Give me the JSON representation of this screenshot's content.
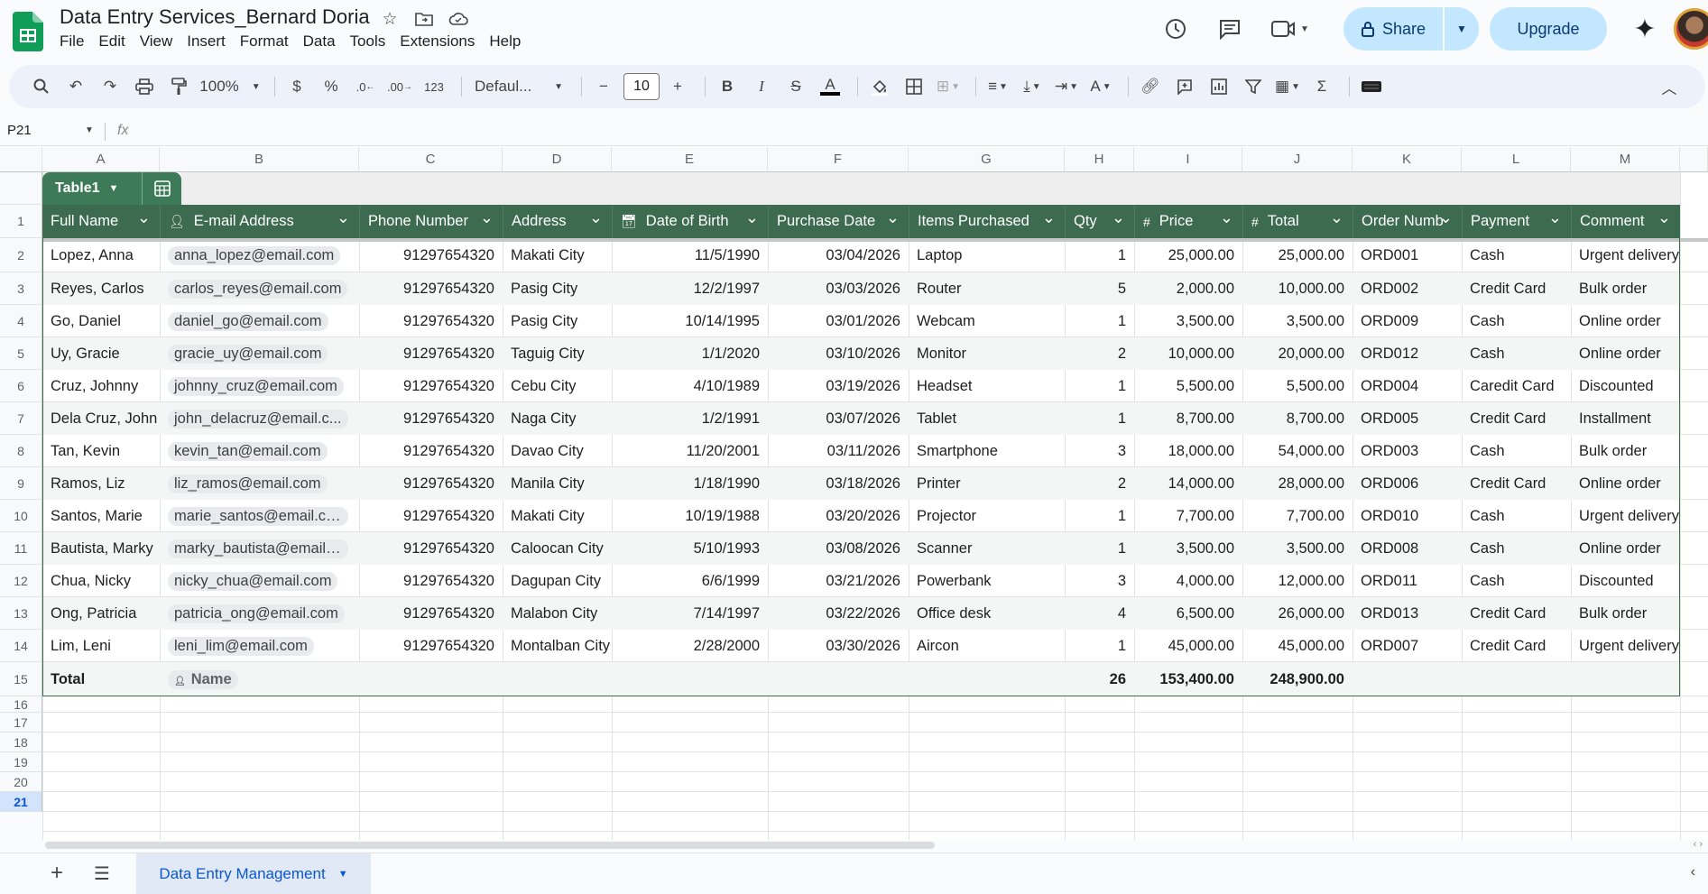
{
  "app": {
    "doc_title": "Data Entry Services_Bernard Doria",
    "menu": [
      "File",
      "Edit",
      "View",
      "Insert",
      "Format",
      "Data",
      "Tools",
      "Extensions",
      "Help"
    ],
    "share_label": "Share",
    "upgrade_label": "Upgrade"
  },
  "toolbar": {
    "zoom": "100%",
    "currency": "$",
    "percent": "%",
    "dec_decrease": ".0",
    "dec_increase": ".00",
    "number_format": "123",
    "font": "Defaul...",
    "font_size": "10"
  },
  "formula_bar": {
    "cell_ref": "P21",
    "fx": "fx"
  },
  "columns": [
    "A",
    "B",
    "C",
    "D",
    "E",
    "F",
    "G",
    "H",
    "I",
    "J",
    "K",
    "L",
    "M"
  ],
  "rows": [
    "1",
    "2",
    "3",
    "4",
    "5",
    "6",
    "7",
    "8",
    "9",
    "10",
    "11",
    "12",
    "13",
    "14",
    "15",
    "16",
    "17",
    "18",
    "19",
    "20",
    "21"
  ],
  "selected_row": "21",
  "table": {
    "name": "Table1",
    "headers": [
      "Full Name",
      "E-mail Address",
      "Phone Number",
      "Address",
      "Date of Birth",
      "Purchase Date",
      "Items Purchased",
      "Qty",
      "Price",
      "Total",
      "Order Numb",
      "Payment",
      "Comment"
    ],
    "records": [
      [
        "Lopez, Anna",
        "anna_lopez@email.com",
        "91297654320",
        "Makati City",
        "11/5/1990",
        "03/04/2026",
        "Laptop",
        "1",
        "25,000.00",
        "25,000.00",
        "ORD001",
        "Cash",
        "Urgent delivery"
      ],
      [
        "Reyes, Carlos",
        "carlos_reyes@email.com",
        "91297654320",
        "Pasig City",
        "12/2/1997",
        "03/03/2026",
        "Router",
        "5",
        "2,000.00",
        "10,000.00",
        "ORD002",
        "Credit Card",
        "Bulk order"
      ],
      [
        "Go, Daniel",
        "daniel_go@email.com",
        "91297654320",
        "Pasig City",
        "10/14/1995",
        "03/01/2026",
        "Webcam",
        "1",
        "3,500.00",
        "3,500.00",
        "ORD009",
        "Cash",
        "Online order"
      ],
      [
        "Uy, Gracie",
        "gracie_uy@email.com",
        "91297654320",
        "Taguig City",
        "1/1/2020",
        "03/10/2026",
        "Monitor",
        "2",
        "10,000.00",
        "20,000.00",
        "ORD012",
        "Cash",
        "Online order"
      ],
      [
        "Cruz, Johnny",
        "johnny_cruz@email.com",
        "91297654320",
        "Cebu City",
        "4/10/1989",
        "03/19/2026",
        "Headset",
        "1",
        "5,500.00",
        "5,500.00",
        "ORD004",
        "Caredit Card",
        "Discounted"
      ],
      [
        "Dela Cruz, John",
        "john_delacruz@email.c...",
        "91297654320",
        "Naga City",
        "1/2/1991",
        "03/07/2026",
        "Tablet",
        "1",
        "8,700.00",
        "8,700.00",
        "ORD005",
        "Credit Card",
        "Installment"
      ],
      [
        "Tan, Kevin",
        "kevin_tan@email.com",
        "91297654320",
        "Davao City",
        "11/20/2001",
        "03/11/2026",
        "Smartphone",
        "3",
        "18,000.00",
        "54,000.00",
        "ORD003",
        "Cash",
        "Bulk order"
      ],
      [
        "Ramos, Liz",
        "liz_ramos@email.com",
        "91297654320",
        "Manila City",
        "1/18/1990",
        "03/18/2026",
        "Printer",
        "2",
        "14,000.00",
        "28,000.00",
        "ORD006",
        "Credit Card",
        "Online order"
      ],
      [
        "Santos, Marie",
        "marie_santos@email.com",
        "91297654320",
        "Makati City",
        "10/19/1988",
        "03/20/2026",
        "Projector",
        "1",
        "7,700.00",
        "7,700.00",
        "ORD010",
        "Cash",
        "Urgent delivery"
      ],
      [
        "Bautista, Marky",
        "marky_bautista@email.c...",
        "91297654320",
        "Caloocan City",
        "5/10/1993",
        "03/08/2026",
        "Scanner",
        "1",
        "3,500.00",
        "3,500.00",
        "ORD008",
        "Cash",
        "Online order"
      ],
      [
        "Chua, Nicky",
        "nicky_chua@email.com",
        "91297654320",
        "Dagupan City",
        "6/6/1999",
        "03/21/2026",
        "Powerbank",
        "3",
        "4,000.00",
        "12,000.00",
        "ORD011",
        "Cash",
        "Discounted"
      ],
      [
        "Ong, Patricia",
        "patricia_ong@email.com",
        "91297654320",
        "Malabon City",
        "7/14/1997",
        "03/22/2026",
        "Office desk",
        "4",
        "6,500.00",
        "26,000.00",
        "ORD013",
        "Credit Card",
        "Bulk order"
      ],
      [
        "Lim, Leni",
        "leni_lim@email.com",
        "91297654320",
        "Montalban City",
        "2/28/2000",
        "03/30/2026",
        "Aircon",
        "1",
        "45,000.00",
        "45,000.00",
        "ORD007",
        "Credit Card",
        "Urgent delivery"
      ]
    ],
    "total_row": {
      "label": "Total",
      "name_chip": "Name",
      "qty": "26",
      "price": "153,400.00",
      "total": "248,900.00"
    }
  },
  "sheet_tab": "Data Entry Management",
  "colors": {
    "table_header": "#3d6b4f",
    "share_bg": "#c2e7ff",
    "accent": "#0b57d0"
  }
}
